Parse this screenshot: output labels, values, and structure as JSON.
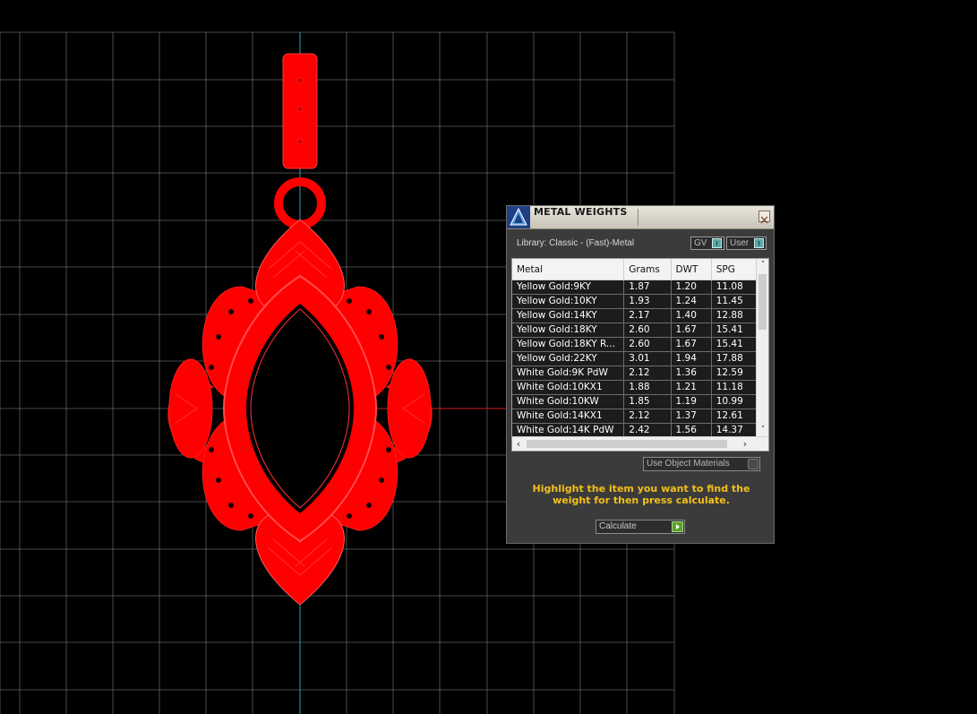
{
  "panel": {
    "title": "METAL WEIGHTS",
    "library_label": "Library: Classic - (Fast)-Metal",
    "gv_toggle_label": "GV",
    "user_toggle_label": "User",
    "columns": [
      "Metal",
      "Grams",
      "DWT",
      "SPG"
    ],
    "rows": [
      [
        "Yellow Gold:9KY",
        "1.87",
        "1.20",
        "11.08"
      ],
      [
        "Yellow Gold:10KY",
        "1.93",
        "1.24",
        "11.45"
      ],
      [
        "Yellow Gold:14KY",
        "2.17",
        "1.40",
        "12.88"
      ],
      [
        "Yellow Gold:18KY",
        "2.60",
        "1.67",
        "15.41"
      ],
      [
        "Yellow Gold:18KY R...",
        "2.60",
        "1.67",
        "15.41"
      ],
      [
        "Yellow Gold:22KY",
        "3.01",
        "1.94",
        "17.88"
      ],
      [
        "White Gold:9K PdW",
        "2.12",
        "1.36",
        "12.59"
      ],
      [
        "White Gold:10KX1",
        "1.88",
        "1.21",
        "11.18"
      ],
      [
        "White Gold:10KW",
        "1.85",
        "1.19",
        "10.99"
      ],
      [
        "White Gold:14KX1",
        "2.12",
        "1.37",
        "12.61"
      ],
      [
        "White Gold:14K PdW",
        "2.42",
        "1.56",
        "14.37"
      ]
    ],
    "use_materials_label": "Use Object Materials",
    "hint": "Highlight the item you want to find the weight for then press calculate.",
    "calculate_label": "Calculate"
  },
  "colors": {
    "model": "#ff0000",
    "grid": "#8a8a8a",
    "axis_y": "#2aa3b8",
    "axis_x": "#d21a1a",
    "hint": "#f3c019"
  }
}
